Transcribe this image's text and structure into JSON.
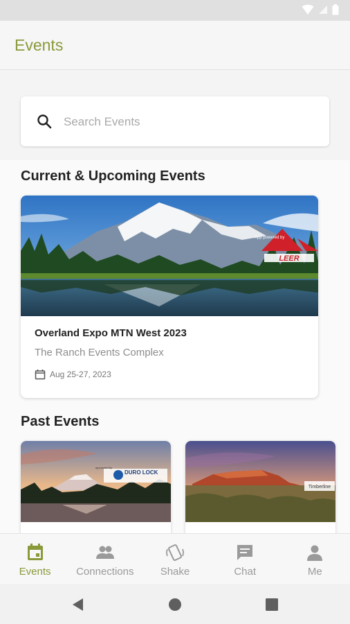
{
  "app": {
    "title": "Events"
  },
  "search": {
    "placeholder": "Search Events"
  },
  "sections": {
    "current_title": "Current & Upcoming Events",
    "past_title": "Past Events"
  },
  "current_event": {
    "title": "Overland Expo MTN West 2023",
    "venue": "The Ranch Events Complex",
    "date": "Aug 25-27, 2023",
    "sponsor_tagline": "App powered by",
    "sponsor_logo": "LEER"
  },
  "past_events": [
    {
      "sponsor_logo": "DURO LOCK",
      "sponsor_tagline": "sponsored by"
    },
    {
      "sponsor_logo": "Timberline"
    }
  ],
  "bottom_nav": [
    {
      "label": "Events",
      "icon": "calendar-icon",
      "active": true
    },
    {
      "label": "Connections",
      "icon": "people-icon",
      "active": false
    },
    {
      "label": "Shake",
      "icon": "shake-icon",
      "active": false
    },
    {
      "label": "Chat",
      "icon": "chat-icon",
      "active": false
    },
    {
      "label": "Me",
      "icon": "person-icon",
      "active": false
    }
  ],
  "colors": {
    "accent": "#8a9a3a",
    "inactive": "#9a9a9a",
    "leer_red": "#d0202a"
  }
}
